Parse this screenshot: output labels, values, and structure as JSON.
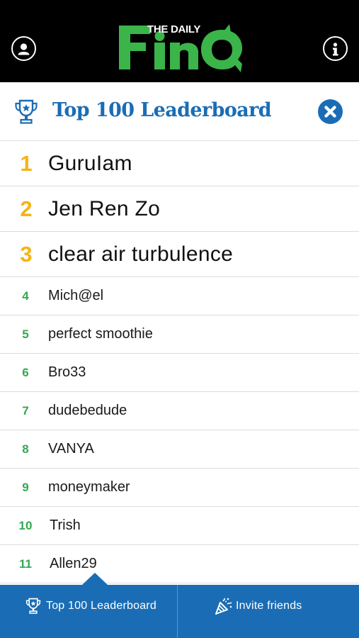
{
  "header": {
    "logo_small_text": "THE DAILY",
    "logo_main_text": "FinQ",
    "colors": {
      "background": "#000000",
      "logo_green": "#3bb44a"
    },
    "profile_icon": "user-icon",
    "info_icon": "info-icon"
  },
  "title_bar": {
    "title": "Top 100 Leaderboard",
    "icon": "trophy-icon",
    "close_icon": "close-icon",
    "accent": "#1a6db5"
  },
  "leaderboard": {
    "top_rank_color": "#f5b417",
    "rank_color": "#33a852",
    "entries": [
      {
        "rank": "1",
        "name": "GuruIam"
      },
      {
        "rank": "2",
        "name": "Jen Ren Zo"
      },
      {
        "rank": "3",
        "name": "clear air turbulence"
      },
      {
        "rank": "4",
        "name": "Mich@el"
      },
      {
        "rank": "5",
        "name": "perfect smoothie"
      },
      {
        "rank": "6",
        "name": "Bro33"
      },
      {
        "rank": "7",
        "name": "dudebedude"
      },
      {
        "rank": "8",
        "name": "VANYA"
      },
      {
        "rank": "9",
        "name": "moneymaker"
      },
      {
        "rank": "10",
        "name": "Trish"
      },
      {
        "rank": "11",
        "name": "Allen29"
      }
    ]
  },
  "tab_bar": {
    "background": "#1a6db5",
    "tabs": [
      {
        "label": "Top 100 Leaderboard",
        "icon": "trophy-icon",
        "selected": true
      },
      {
        "label": "Invite friends",
        "icon": "party-popper-icon",
        "selected": false
      }
    ]
  }
}
